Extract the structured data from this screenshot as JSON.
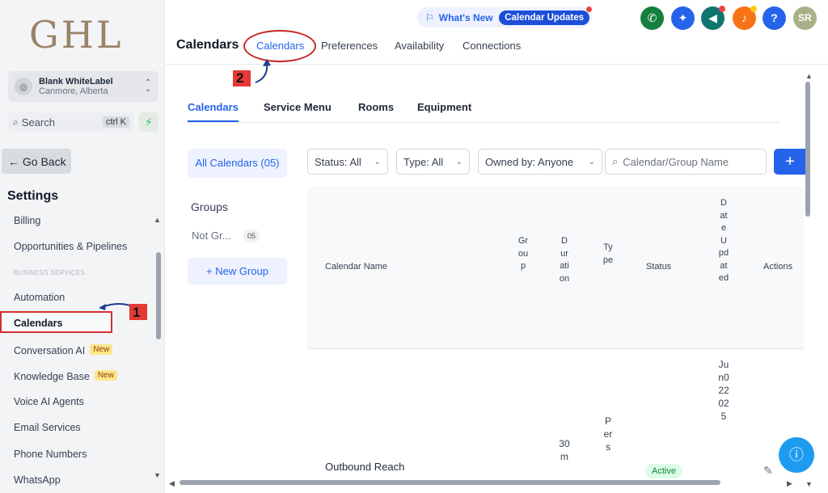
{
  "sidebar": {
    "logo": "GHL",
    "account_name": "Blank WhiteLabel",
    "account_location": "Canmore, Alberta",
    "search_label": "Search",
    "search_shortcut": "ctrl K",
    "go_back": "← Go Back",
    "settings_heading": "Settings",
    "section_label": "BUSINESS SERVICES",
    "items": [
      {
        "label": "Billing"
      },
      {
        "label": "Opportunities & Pipelines"
      },
      {
        "label": "Automation"
      },
      {
        "label": "Calendars"
      },
      {
        "label": "Conversation AI",
        "badge": "New"
      },
      {
        "label": "Knowledge Base",
        "badge": "New"
      },
      {
        "label": "Voice AI Agents"
      },
      {
        "label": "Email Services"
      },
      {
        "label": "Phone Numbers"
      },
      {
        "label": "WhatsApp"
      }
    ]
  },
  "header": {
    "title": "Calendars",
    "tabs": [
      "Calendars",
      "Preferences",
      "Availability",
      "Connections"
    ],
    "active_tab": "Calendars",
    "whats_new": "What's New",
    "calendar_updates": "Calendar Updates",
    "avatar": "SR",
    "help": "?"
  },
  "content_tabs": [
    "Calendars",
    "Service Menu",
    "Rooms",
    "Equipment"
  ],
  "groups_panel": {
    "all_calendars": "All Calendars (05)",
    "groups_heading": "Groups",
    "not_grouped": "Not Gr...",
    "not_grouped_count": "05",
    "new_group": "+ New Group"
  },
  "filters": {
    "status": "Status: All",
    "type": "Type: All",
    "owned_by": "Owned by: Anyone",
    "search_placeholder": "Calendar/Group Name",
    "add": "+"
  },
  "table": {
    "columns": [
      "Calendar Name",
      "Group",
      "Duration",
      "Type",
      "Status",
      "Date Updated",
      "Actions"
    ],
    "rows": [
      {
        "name": "Outbound Reach",
        "duration": "30m",
        "type": "Pers",
        "status": "Active",
        "date_updated": "Jun022025"
      }
    ]
  },
  "annotations": [
    "1",
    "2"
  ],
  "colors": {
    "accent": "#2563eb",
    "annotation_red": "#d32f2f"
  }
}
